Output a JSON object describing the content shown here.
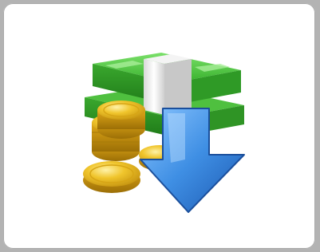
{
  "icon": {
    "name": "money-download-icon",
    "components": [
      "banknote-stack-icon",
      "gold-coins-icon",
      "download-arrow-icon"
    ]
  },
  "colors": {
    "background": "#b3b3b3",
    "card": "#ffffff",
    "bill_green": "#3fb833",
    "bill_dark": "#2a8f22",
    "band": "#e8e8e8",
    "coin_gold": "#e6b820",
    "coin_dark": "#b88a0a",
    "arrow_blue": "#3b8fe0",
    "arrow_dark": "#1f5fb5"
  }
}
